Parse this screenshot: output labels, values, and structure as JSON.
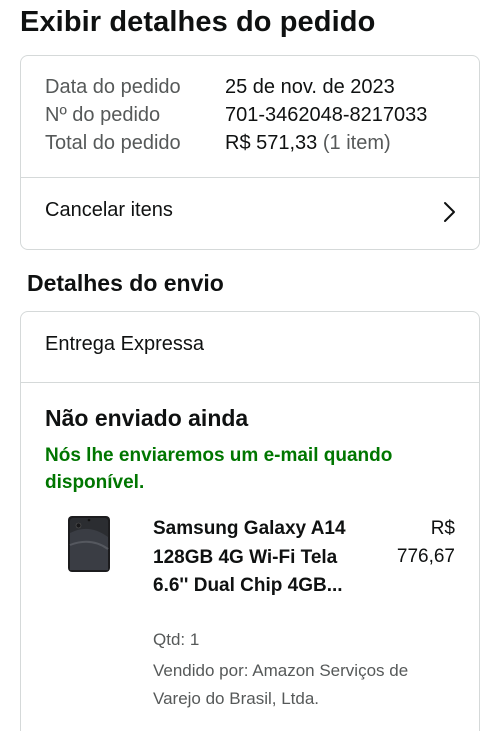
{
  "page": {
    "title": "Exibir detalhes do pedido"
  },
  "summary": {
    "date_label": "Data do pedido",
    "date_value": "25 de nov. de 2023",
    "number_label": "Nº do pedido",
    "number_value": "701-3462048-8217033",
    "total_label": "Total do pedido",
    "total_value": "R$ 571,33",
    "total_items": "(1 item)",
    "cancel_label": "Cancelar itens"
  },
  "shipping": {
    "section_title": "Detalhes do envio",
    "delivery_type": "Entrega Expressa",
    "status_title": "Não enviado ainda",
    "status_note": "Nós lhe enviaremos um e-mail quando disponível."
  },
  "product": {
    "name": "Samsung Galaxy A14 128GB 4G Wi-Fi Tela 6.6'' Dual Chip 4GB...",
    "price": "R$ 776,67",
    "quantity": "Qtd: 1",
    "seller": "Vendido por: Amazon Serviços de Varejo do Brasil, Ltda."
  },
  "colors": {
    "status_green": "#007600",
    "border": "#d5d9d9",
    "muted_text": "#565959"
  }
}
